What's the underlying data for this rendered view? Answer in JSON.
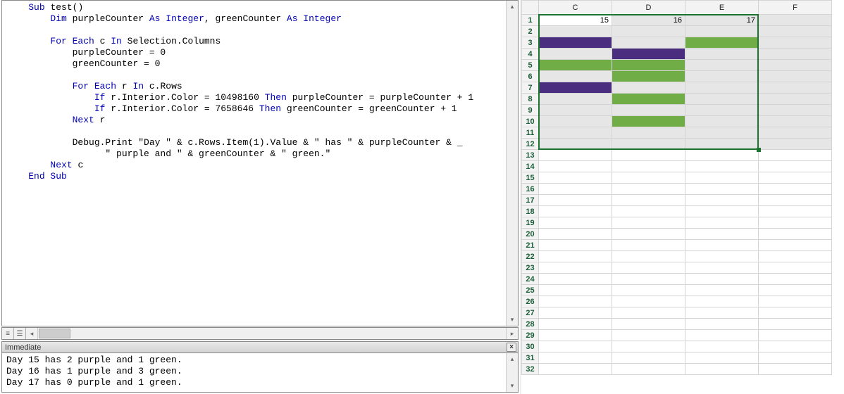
{
  "code": {
    "lines": [
      {
        "indent": 1,
        "tokens": [
          {
            "t": "Sub ",
            "k": 1
          },
          {
            "t": "test()",
            "k": 0
          }
        ]
      },
      {
        "indent": 2,
        "tokens": [
          {
            "t": "Dim ",
            "k": 1
          },
          {
            "t": "purpleCounter ",
            "k": 0
          },
          {
            "t": "As Integer",
            "k": 1
          },
          {
            "t": ", greenCounter ",
            "k": 0
          },
          {
            "t": "As Integer",
            "k": 1
          }
        ]
      },
      {
        "indent": 0,
        "tokens": [
          {
            "t": "",
            "k": 0
          }
        ]
      },
      {
        "indent": 2,
        "tokens": [
          {
            "t": "For Each ",
            "k": 1
          },
          {
            "t": "c ",
            "k": 0
          },
          {
            "t": "In ",
            "k": 1
          },
          {
            "t": "Selection.Columns",
            "k": 0
          }
        ]
      },
      {
        "indent": 3,
        "tokens": [
          {
            "t": "purpleCounter = 0",
            "k": 0
          }
        ]
      },
      {
        "indent": 3,
        "tokens": [
          {
            "t": "greenCounter = 0",
            "k": 0
          }
        ]
      },
      {
        "indent": 0,
        "tokens": [
          {
            "t": "",
            "k": 0
          }
        ]
      },
      {
        "indent": 3,
        "tokens": [
          {
            "t": "For Each ",
            "k": 1
          },
          {
            "t": "r ",
            "k": 0
          },
          {
            "t": "In ",
            "k": 1
          },
          {
            "t": "c.Rows",
            "k": 0
          }
        ]
      },
      {
        "indent": 4,
        "tokens": [
          {
            "t": "If ",
            "k": 1
          },
          {
            "t": "r.Interior.Color = 10498160 ",
            "k": 0
          },
          {
            "t": "Then ",
            "k": 1
          },
          {
            "t": "purpleCounter = purpleCounter + 1",
            "k": 0
          }
        ]
      },
      {
        "indent": 4,
        "tokens": [
          {
            "t": "If ",
            "k": 1
          },
          {
            "t": "r.Interior.Color = 7658646 ",
            "k": 0
          },
          {
            "t": "Then ",
            "k": 1
          },
          {
            "t": "greenCounter = greenCounter + 1",
            "k": 0
          }
        ]
      },
      {
        "indent": 3,
        "tokens": [
          {
            "t": "Next ",
            "k": 1
          },
          {
            "t": "r",
            "k": 0
          }
        ]
      },
      {
        "indent": 0,
        "tokens": [
          {
            "t": "",
            "k": 0
          }
        ]
      },
      {
        "indent": 3,
        "tokens": [
          {
            "t": "Debug.Print \"Day \" & c.Rows.Item(1).Value & \" has \" & purpleCounter & _",
            "k": 0
          }
        ]
      },
      {
        "indent": 4,
        "tokens": [
          {
            "t": "  \" purple and \" & greenCounter & \" green.\"",
            "k": 0
          }
        ]
      },
      {
        "indent": 2,
        "tokens": [
          {
            "t": "Next ",
            "k": 1
          },
          {
            "t": "c",
            "k": 0
          }
        ]
      },
      {
        "indent": 1,
        "tokens": [
          {
            "t": "End Sub",
            "k": 1
          }
        ]
      }
    ]
  },
  "immediate": {
    "title": "Immediate",
    "lines": [
      "Day 15 has 2 purple and 1 green.",
      "Day 16 has 1 purple and 3 green.",
      "Day 17 has 0 purple and 1 green."
    ]
  },
  "sheet": {
    "columns": [
      "C",
      "D",
      "E",
      "F"
    ],
    "rows": [
      1,
      2,
      3,
      4,
      5,
      6,
      7,
      8,
      9,
      10,
      11,
      12,
      13,
      14,
      15,
      16,
      17,
      18,
      19,
      20,
      21,
      22,
      23,
      24,
      25,
      26,
      27,
      28,
      29,
      30,
      31,
      32
    ],
    "values": {
      "r1": {
        "C": "15",
        "D": "16",
        "E": "17"
      }
    },
    "selection": {
      "fromRow": 1,
      "toRow": 12,
      "cols": [
        "C",
        "D",
        "E"
      ],
      "activeRow": 1,
      "activeCol": "C"
    },
    "fills": {
      "purple": [
        [
          3,
          "C"
        ],
        [
          4,
          "D"
        ],
        [
          7,
          "C"
        ]
      ],
      "green": [
        [
          3,
          "E"
        ],
        [
          5,
          "C"
        ],
        [
          5,
          "D"
        ],
        [
          6,
          "D"
        ],
        [
          8,
          "D"
        ],
        [
          10,
          "D"
        ]
      ]
    }
  }
}
